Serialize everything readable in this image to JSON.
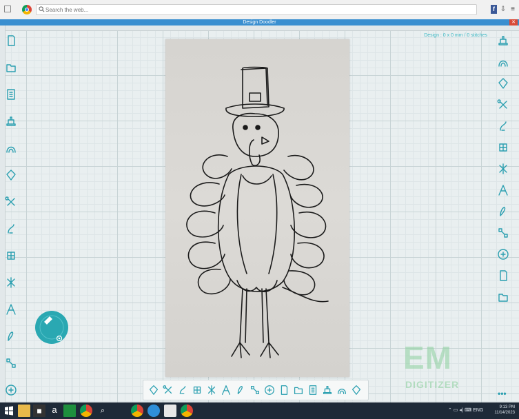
{
  "browser": {
    "search_placeholder": "Search the web..."
  },
  "app": {
    "title": "Design Doodler",
    "design_info": "Design : 0 x 0 mm / 0 stitches"
  },
  "left_tools": [
    "new-file-icon",
    "open-folder-icon",
    "document-icon",
    "embroidery-machine-icon",
    "hoop-icon",
    "shape-tool-icon",
    "scissors-icon",
    "stitch-tool-icon",
    "fill-tool-icon",
    "cross-stitch-icon",
    "text-letter-icon",
    "pen-tool-icon",
    "node-edit-icon",
    "color-picker-icon"
  ],
  "right_tools": [
    "frame-icon",
    "square-icon",
    "puzzle-icon",
    "grid-pattern-icon",
    "stitch-select-icon",
    "layer-up-icon",
    "layer-down-icon",
    "ghost-icon",
    "lock-icon",
    "page-settings-icon",
    "align-icon",
    "layers-icon",
    "globe-icon"
  ],
  "bottom_tools": [
    "select-arrow-icon",
    "select-box-icon",
    "move-icon",
    "rotate-icon",
    "zoom-icon",
    "pan-hand-icon",
    "measure-icon",
    "resize-icon",
    "transform-icon",
    "mirror-icon",
    "flip-icon",
    "page-icon",
    "page-image-icon",
    "page-cut-icon",
    "monitor-icon"
  ],
  "watermark": {
    "logo": "EM",
    "sub": "DIGITIZER"
  },
  "taskbar": {
    "time": "9:13 PM",
    "date": "11/14/2023"
  },
  "colors": {
    "accent": "#2a9fb0",
    "titlebar": "#3a8fd0",
    "taskbar": "#1e2a38"
  }
}
